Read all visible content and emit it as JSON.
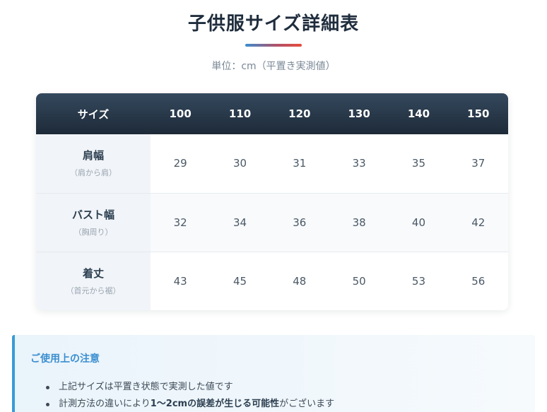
{
  "page": {
    "title": "子供服サイズ詳細表",
    "unit": "単位：cm（平置き実測値）"
  },
  "colors": {
    "header_bg": "#2c3e50",
    "accent_blue": "#3a9bd5",
    "accent_red": "#e74c3c",
    "label_bg": "#f1f4f8"
  },
  "table": {
    "corner_label": "サイズ",
    "sizes": [
      "100",
      "110",
      "120",
      "130",
      "140",
      "150"
    ],
    "rows": [
      {
        "label": "肩幅",
        "sub": "（肩から肩）",
        "values": [
          "29",
          "30",
          "31",
          "33",
          "35",
          "37"
        ]
      },
      {
        "label": "バスト幅",
        "sub": "（胸周り）",
        "values": [
          "32",
          "34",
          "36",
          "38",
          "40",
          "42"
        ]
      },
      {
        "label": "着丈",
        "sub": "（首元から裾）",
        "values": [
          "43",
          "45",
          "48",
          "50",
          "53",
          "56"
        ]
      }
    ]
  },
  "notice": {
    "title": "ご使用上の注意",
    "item1": "上記サイズは平置き状態で実測した値です",
    "item2_prefix": "計測方法の違いにより",
    "item2_bold": "1〜2cmの誤差が生じる可能性",
    "item2_suffix": "がございます"
  }
}
